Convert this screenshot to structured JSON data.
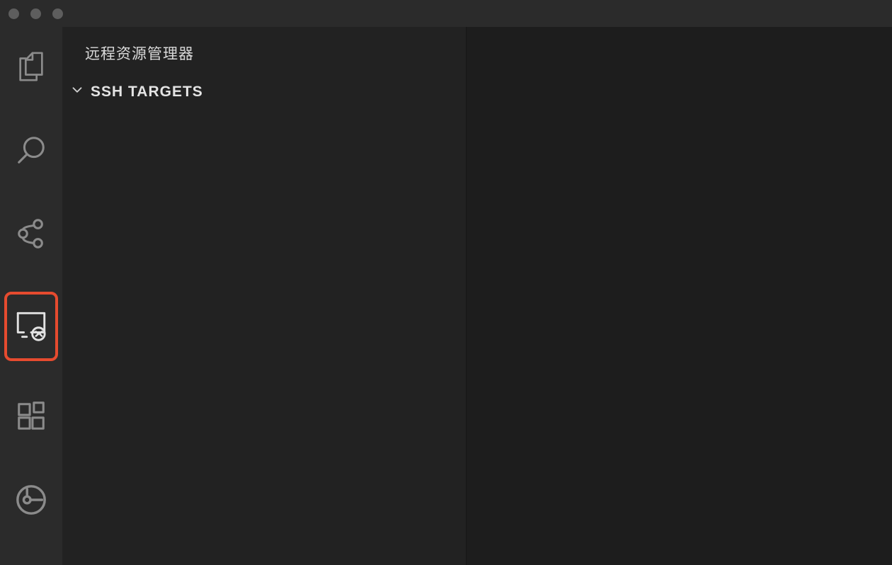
{
  "sidebar": {
    "title": "远程资源管理器",
    "section_label": "SSH TARGETS"
  },
  "activitybar": {
    "items": [
      {
        "name": "explorer-icon"
      },
      {
        "name": "search-icon"
      },
      {
        "name": "source-control-icon"
      },
      {
        "name": "remote-explorer-icon"
      },
      {
        "name": "extensions-icon"
      },
      {
        "name": "gitlens-icon"
      }
    ]
  }
}
